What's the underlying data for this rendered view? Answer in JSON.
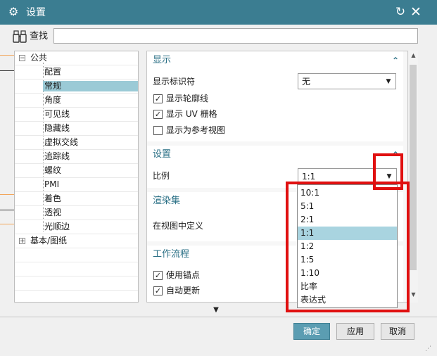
{
  "window": {
    "title": "设置"
  },
  "search": {
    "label": "查找",
    "value": "",
    "placeholder": ""
  },
  "tree": {
    "root1": "公共",
    "children": [
      "配置",
      "常规",
      "角度",
      "可见线",
      "隐藏线",
      "虚拟交线",
      "追踪线",
      "螺纹",
      "PMI",
      "着色",
      "透视",
      "光顺边"
    ],
    "selected": "常规",
    "root2": "基本/图纸",
    "expander_open": "−",
    "expander_closed": "+"
  },
  "display": {
    "title": "显示",
    "identifier_label": "显示标识符",
    "identifier_value": "无",
    "checkboxes": [
      {
        "label": "显示轮廓线",
        "checked": true
      },
      {
        "label": "显示 UV 栅格",
        "checked": true
      },
      {
        "label": "显示为参考视图",
        "checked": false
      }
    ]
  },
  "settings": {
    "title": "设置",
    "scale_label": "比例",
    "scale_value": "1:1"
  },
  "render_set": {
    "title": "渲染集",
    "define_label": "在视图中定义"
  },
  "workflow": {
    "title": "工作流程",
    "checkboxes": [
      {
        "label": "使用锚点",
        "checked": true
      },
      {
        "label": "自动更新",
        "checked": true
      }
    ]
  },
  "scale_dropdown": {
    "options": [
      "10:1",
      "5:1",
      "2:1",
      "1:1",
      "1:2",
      "1:5",
      "1:10",
      "比率",
      "表达式"
    ],
    "selected_index": 3
  },
  "buttons": {
    "ok": "确定",
    "apply": "应用",
    "cancel": "取消"
  },
  "icons": {
    "gear": "⚙",
    "reset": "↻",
    "close": "✕",
    "caret_up": "⌃",
    "chevron_down": "▼",
    "check": "✓",
    "scroll_up": "▲",
    "scroll_down": "▼",
    "more": "▼",
    "grip": "⋰"
  },
  "colors": {
    "titlebar": "#3b7d91",
    "accent_text": "#2a6f85",
    "selection": "#9bcad6",
    "annotation": "#e01010",
    "ok_button": "#5b9db2"
  }
}
